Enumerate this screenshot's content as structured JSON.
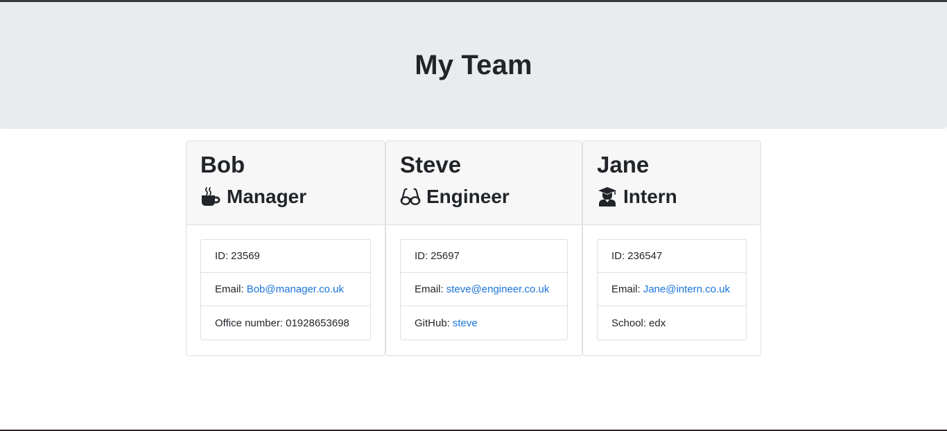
{
  "page": {
    "title": "My Team"
  },
  "team": [
    {
      "name": "Bob",
      "role": "Manager",
      "icon": "coffee-mug-icon",
      "id_label": "ID:",
      "id_value": "23569",
      "email_label": "Email:",
      "email_value": "Bob@manager.co.uk",
      "extra_label": "Office number:",
      "extra_value": "01928653698"
    },
    {
      "name": "Steve",
      "role": "Engineer",
      "icon": "glasses-icon",
      "id_label": "ID:",
      "id_value": "25697",
      "email_label": "Email:",
      "email_value": "steve@engineer.co.uk",
      "extra_label": "GitHub:",
      "extra_value": "steve"
    },
    {
      "name": "Jane",
      "role": "Intern",
      "icon": "graduate-icon",
      "id_label": "ID:",
      "id_value": "236547",
      "email_label": "Email:",
      "email_value": "Jane@intern.co.uk",
      "extra_label": "School:",
      "extra_value": "edx"
    }
  ],
  "colors": {
    "link": "#1a73d9",
    "header_bg": "#e9ecef",
    "card_header_bg": "#f7f7f7"
  }
}
